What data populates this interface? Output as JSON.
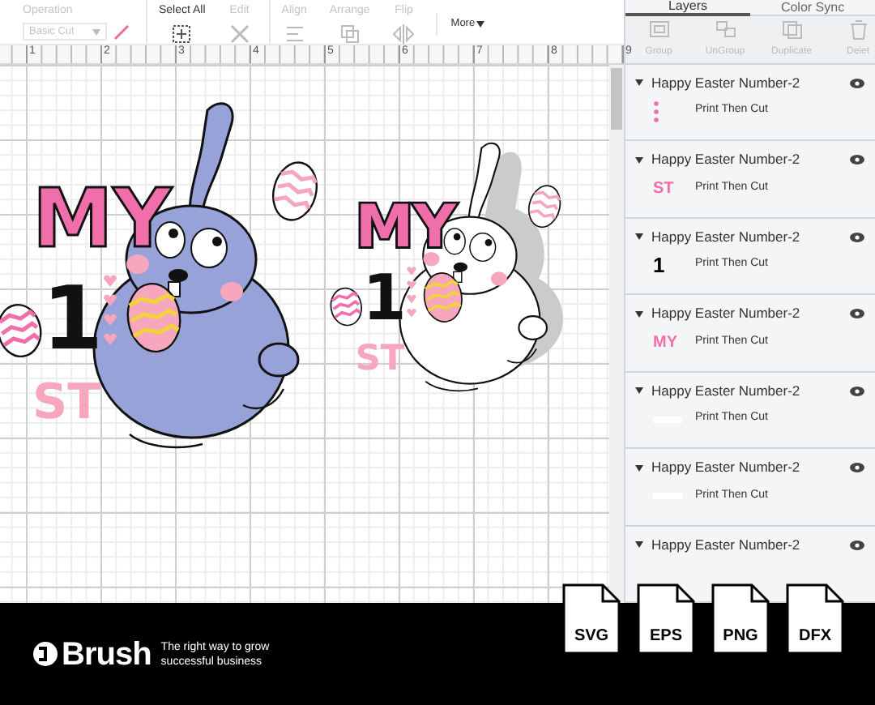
{
  "toolbar": {
    "groups": [
      {
        "label": "Operation",
        "kind": "select",
        "value": "Basic Cut",
        "disabled": true
      },
      {
        "label": "Select All",
        "kind": "select_all",
        "disabled": false
      },
      {
        "label": "Edit",
        "kind": "edit",
        "disabled": true
      },
      {
        "label": "Align",
        "kind": "align",
        "disabled": true
      },
      {
        "label": "Arrange",
        "kind": "arrange",
        "disabled": true
      },
      {
        "label": "Flip",
        "kind": "flip",
        "disabled": true
      }
    ],
    "more": "More"
  },
  "ruler": [
    "1",
    "2",
    "3",
    "4",
    "5",
    "6",
    "7",
    "8",
    "9"
  ],
  "designs": [
    {
      "kind": "color",
      "title": "MY",
      "number": "1",
      "suffix": "ST"
    },
    {
      "kind": "outline",
      "title": "MY",
      "number": "1",
      "suffix": "ST"
    }
  ],
  "panel": {
    "tabs": [
      {
        "label": "Layers",
        "selected": true
      },
      {
        "label": "Color Sync",
        "selected": false
      }
    ],
    "actions": [
      {
        "label": "Group",
        "kind": "group"
      },
      {
        "label": "UnGroup",
        "kind": "ungroup"
      },
      {
        "label": "Duplicate",
        "kind": "duplicate"
      },
      {
        "label": "Delet",
        "kind": "delete"
      }
    ],
    "layers": [
      {
        "name": "Happy Easter Number-2",
        "operation": "Print Then Cut",
        "kind": "hearts"
      },
      {
        "name": "Happy Easter Number-2",
        "operation": "Print Then Cut",
        "kind": "pinktext",
        "thumb_text": "ST"
      },
      {
        "name": "Happy Easter Number-2",
        "operation": "Print Then Cut",
        "kind": "blacktext",
        "thumb_text": "1"
      },
      {
        "name": "Happy Easter Number-2",
        "operation": "Print Then Cut",
        "kind": "pinktext",
        "thumb_text": "MY"
      },
      {
        "name": "Happy Easter Number-2",
        "operation": "Print Then Cut",
        "kind": "blank"
      },
      {
        "name": "Happy Easter Number-2",
        "operation": "Print Then Cut",
        "kind": "blank"
      },
      {
        "name": "Happy Easter Number-2"
      }
    ]
  },
  "banner": {
    "brand": "Brush",
    "tagline": [
      "The right way to grow",
      "successful business"
    ],
    "formats": [
      "SVG",
      "EPS",
      "PNG",
      "DFX"
    ]
  }
}
